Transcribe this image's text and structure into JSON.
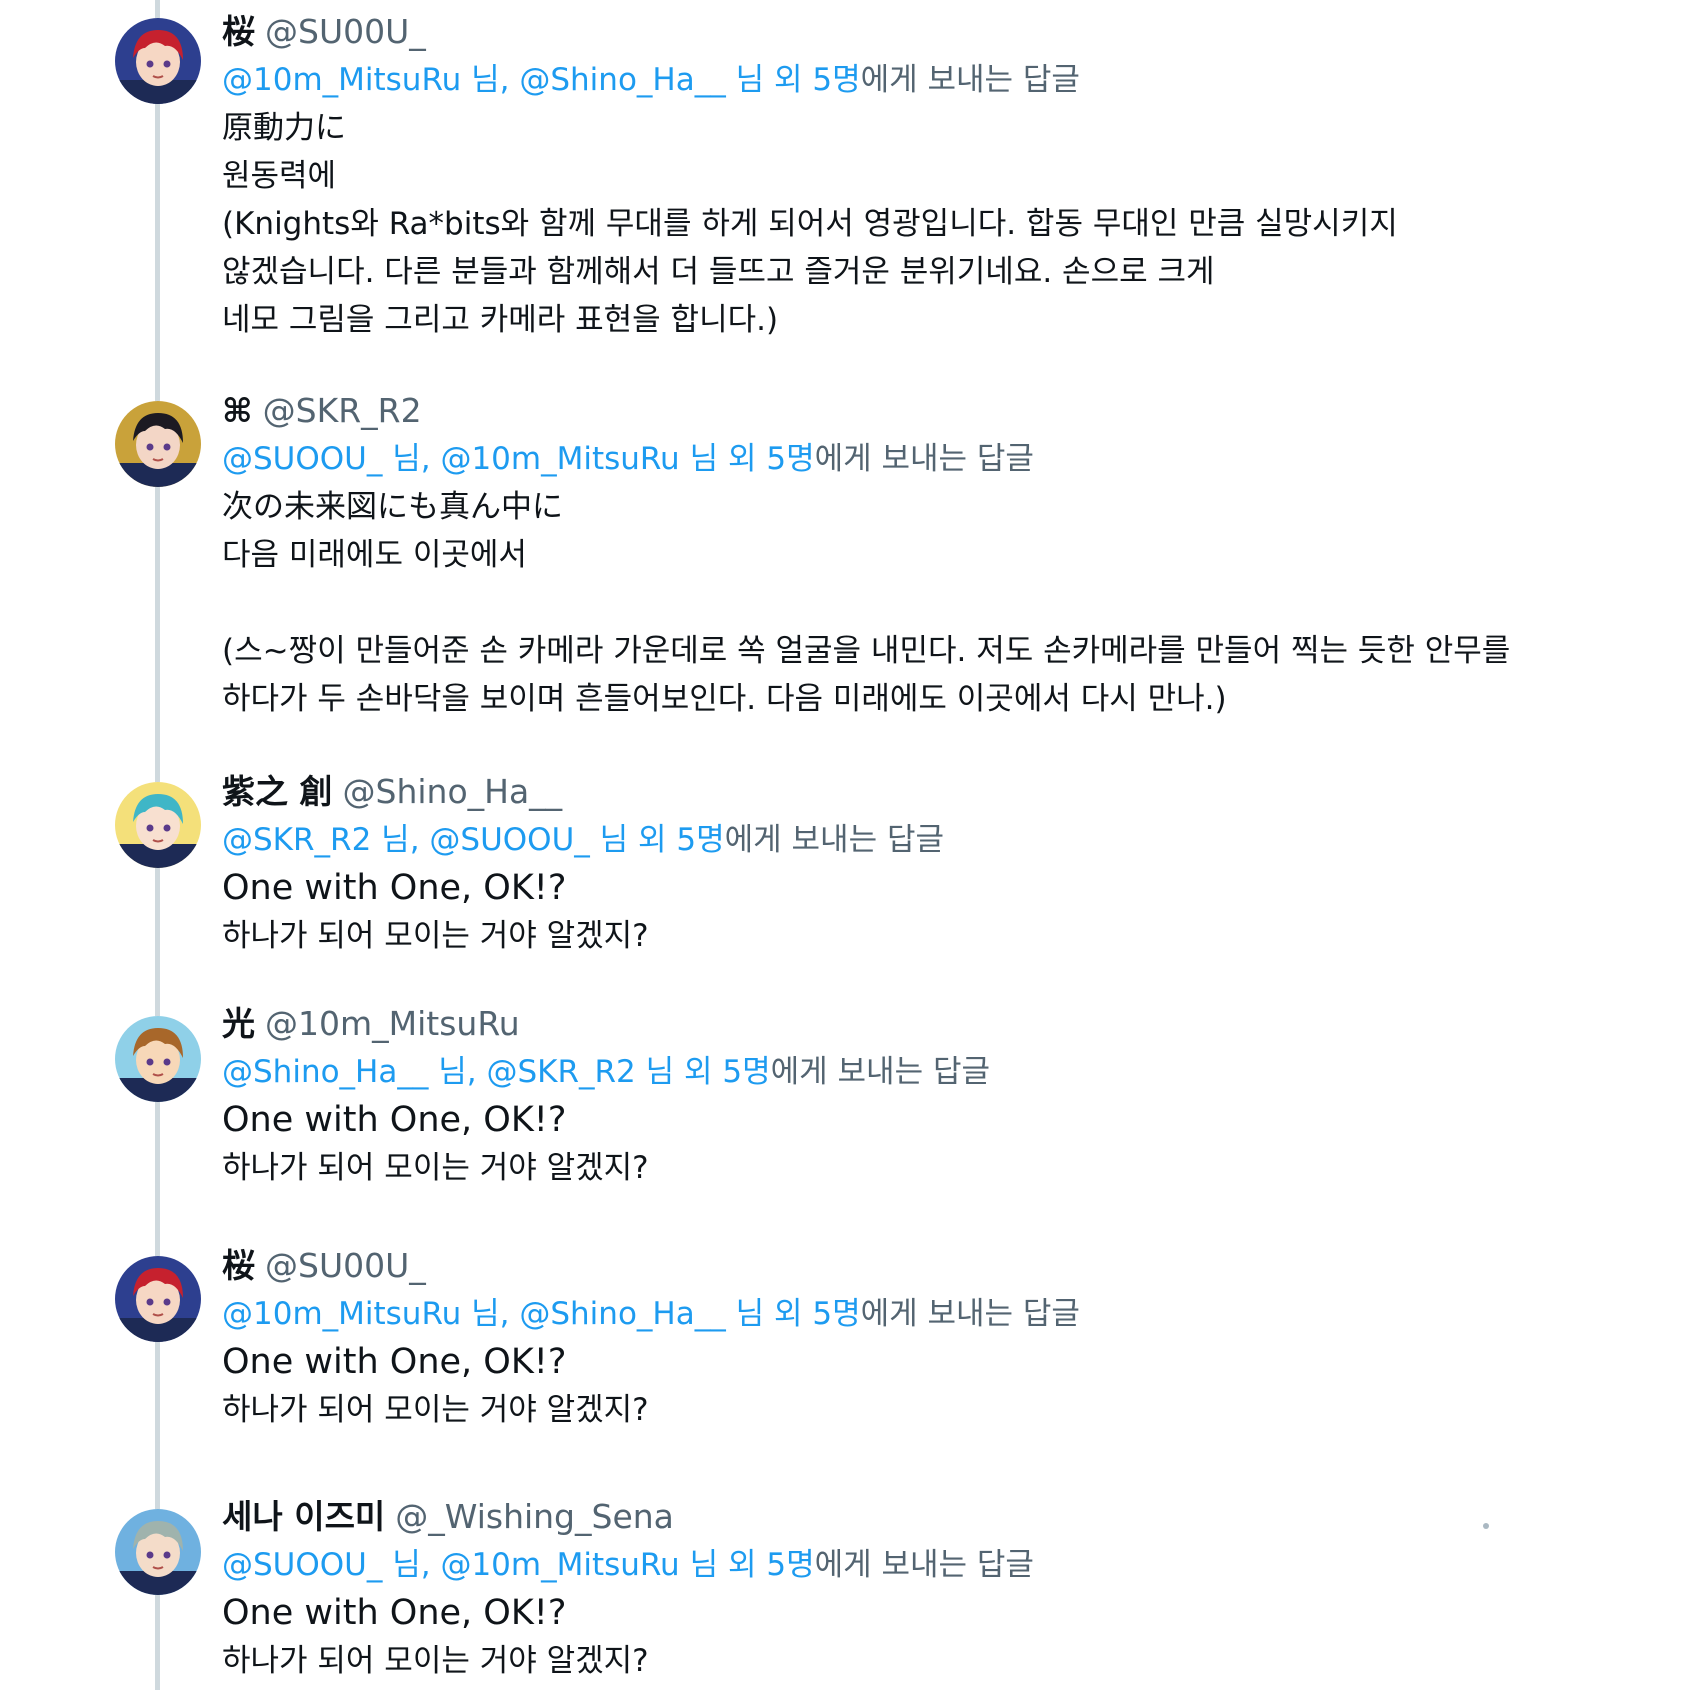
{
  "thread": [
    {
      "display_name": "桜",
      "handle": "@SU00U_",
      "avatar_colors": {
        "hair": "#c6212e",
        "skin": "#f6d7c4",
        "bg": "#2d3f8f"
      },
      "reply": {
        "mention_1": "@10m_MitsuRu",
        "sep_1": "님,",
        "mention_2": "@Shino_Ha__",
        "sep_2": "님 외",
        "count": "5명",
        "suffix": "에게 보내는 답글"
      },
      "lines": [
        "原動力に",
        "원동력에",
        "(Knights와 Ra*bits와 함께 무대를 하게 되어서 영광입니다. 합동 무대인 만큼 실망시키지",
        "않겠습니다. 다른 분들과 함께해서 더 들뜨고 즐거운 분위기네요. 손으로 크게",
        "네모 그림을 그리고 카메라 표현을 합니다.)"
      ]
    },
    {
      "display_name": "⌘",
      "handle": "@SKR_R2",
      "avatar_colors": {
        "hair": "#1c1a22",
        "skin": "#f3d6c6",
        "bg": "#c9a23a"
      },
      "reply": {
        "mention_1": "@SUOOU_",
        "sep_1": "님,",
        "mention_2": "@10m_MitsuRu",
        "sep_2": "님 외",
        "count": "5명",
        "suffix": "에게 보내는 답글"
      },
      "lines": [
        "次の未来図にも真ん中に",
        "다음 미래에도 이곳에서",
        "",
        "(스~짱이 만들어준 손 카메라 가운데로 쏙 얼굴을 내민다. 저도 손카메라를 만들어 찍는 듯한 안무를",
        "하다가 두 손바닥을 보이며 흔들어보인다. 다음 미래에도 이곳에서 다시 만나.)"
      ]
    },
    {
      "display_name": "紫之 創",
      "handle": "@Shino_Ha__",
      "avatar_colors": {
        "hair": "#3fb6c7",
        "skin": "#f8e0d0",
        "bg": "#f4e07a"
      },
      "reply": {
        "mention_1": "@SKR_R2",
        "sep_1": "님,",
        "mention_2": "@SUOOU_",
        "sep_2": "님 외",
        "count": "5명",
        "suffix": "에게 보내는 답글"
      },
      "lines": [
        "One with One, OK!?",
        "하나가 되어 모이는 거야 알겠지?"
      ]
    },
    {
      "display_name": "光",
      "handle": "@10m_MitsuRu",
      "avatar_colors": {
        "hair": "#a8672a",
        "skin": "#f7d8b8",
        "bg": "#8fd0e8"
      },
      "reply": {
        "mention_1": "@Shino_Ha__",
        "sep_1": "님,",
        "mention_2": "@SKR_R2",
        "sep_2": "님 외",
        "count": "5명",
        "suffix": "에게 보내는 답글"
      },
      "lines": [
        "One with One, OK!?",
        "하나가 되어 모이는 거야 알겠지?"
      ]
    },
    {
      "display_name": "桜",
      "handle": "@SU00U_",
      "avatar_colors": {
        "hair": "#c6212e",
        "skin": "#f6d7c4",
        "bg": "#2d3f8f"
      },
      "reply": {
        "mention_1": "@10m_MitsuRu",
        "sep_1": "님,",
        "mention_2": "@Shino_Ha__",
        "sep_2": "님 외",
        "count": "5명",
        "suffix": "에게 보내는 답글"
      },
      "lines": [
        "One with One, OK!?",
        "하나가 되어 모이는 거야 알겠지?"
      ]
    },
    {
      "display_name": "세나 이즈미",
      "handle": "@_Wishing_Sena",
      "avatar_colors": {
        "hair": "#9fb3ad",
        "skin": "#f4dcc9",
        "bg": "#6fb1e0"
      },
      "reply": {
        "mention_1": "@SUOOU_",
        "sep_1": "님,",
        "mention_2": "@10m_MitsuRu",
        "sep_2": "님 외",
        "count": "5명",
        "suffix": "에게 보내는 답글"
      },
      "lines": [
        "One with One, OK!?",
        "하나가 되어 모이는 거야 알겠지?"
      ]
    }
  ]
}
